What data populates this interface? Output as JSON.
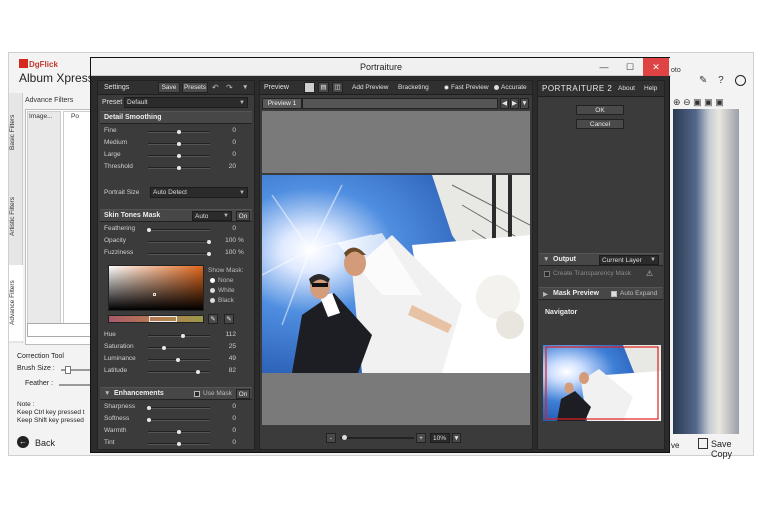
{
  "host": {
    "brand": "DgFlick",
    "title": "Album Xpress",
    "side_tabs": [
      "Basic Filters",
      "Artistic Filters",
      "Advance Filters"
    ],
    "advance_filters_label": "Advance Filters",
    "image_col_label": "Image...",
    "col2_label": "Po",
    "correction_tool_label": "Correction Tool",
    "brush_size_label": "Brush Size :",
    "feather_label": "Feather :",
    "note_label": "Note :",
    "note_line1": "Keep Ctrl key pressed t",
    "note_line2": "Keep Shift key pressed",
    "back_label": "Back",
    "right_top_text": "oto",
    "right_ve_text": "ve",
    "save_copy_label": "Save Copy"
  },
  "window": {
    "title": "Portraiture",
    "minimize": "—",
    "maximize": "☐",
    "close": "✕"
  },
  "left": {
    "settings_label": "Settings",
    "save_label": "Save",
    "presets_label": "Presets",
    "preset_label": "Preset",
    "preset_value": "Default",
    "detail_smoothing": {
      "title": "Detail Smoothing",
      "sliders": [
        {
          "label": "Fine",
          "value": "0",
          "pos": 0.5
        },
        {
          "label": "Medium",
          "value": "0",
          "pos": 0.5
        },
        {
          "label": "Large",
          "value": "0",
          "pos": 0.5
        },
        {
          "label": "Threshold",
          "value": "20",
          "pos": 0.5
        }
      ],
      "portrait_size_label": "Portrait Size",
      "portrait_size_value": "Auto Detect"
    },
    "skin_tones": {
      "title": "Skin Tones Mask",
      "mode_value": "Auto",
      "on_label": "On",
      "sliders": [
        {
          "label": "Feathering",
          "value": "0",
          "unit": "",
          "pos": 0.0
        },
        {
          "label": "Opacity",
          "value": "100",
          "unit": "%",
          "pos": 1.0
        },
        {
          "label": "Fuzziness",
          "value": "100",
          "unit": "%",
          "pos": 1.0
        }
      ],
      "show_mask_label": "Show Mask:",
      "mask_options": [
        "None",
        "White",
        "Black"
      ],
      "hsl_sliders": [
        {
          "label": "Hue",
          "value": "112",
          "pos": 0.56
        },
        {
          "label": "Saturation",
          "value": "25",
          "pos": 0.25
        },
        {
          "label": "Luminance",
          "value": "49",
          "pos": 0.49
        },
        {
          "label": "Latitude",
          "value": "82",
          "pos": 0.82
        }
      ],
      "picker_color": "#c9772f"
    },
    "enhancements": {
      "title": "Enhancements",
      "use_mask_label": "Use Mask",
      "on_label": "On",
      "sliders": [
        {
          "label": "Sharpness",
          "value": "0",
          "pos": 0.0
        },
        {
          "label": "Softness",
          "value": "0",
          "pos": 0.0
        },
        {
          "label": "Warmth",
          "value": "0",
          "pos": 0.5
        },
        {
          "label": "Tint",
          "value": "0",
          "pos": 0.5
        }
      ]
    }
  },
  "center": {
    "preview_label": "Preview",
    "add_preview_label": "Add Preview",
    "bracketing_label": "Bracketing",
    "fast_preview_label": "Fast Preview",
    "accurate_label": "Accurate",
    "tab_label": "Preview 1",
    "zoom_value": "10%",
    "minus_label": "-",
    "plus_label": "+"
  },
  "right": {
    "brand_title": "PORTRAITURE 2",
    "about_label": "About",
    "help_label": "Help",
    "ok_label": "OK",
    "cancel_label": "Cancel",
    "output_label": "Output",
    "output_value": "Current Layer",
    "create_transparency_label": "Create Transparency Mask",
    "mask_preview_label": "Mask Preview",
    "auto_expand_label": "Auto Expand",
    "navigator_label": "Navigator"
  },
  "colors": {
    "accent_red": "#d42a1e",
    "panel_bg": "#3b3b3b",
    "sky_blue": "#2f6fd0"
  }
}
